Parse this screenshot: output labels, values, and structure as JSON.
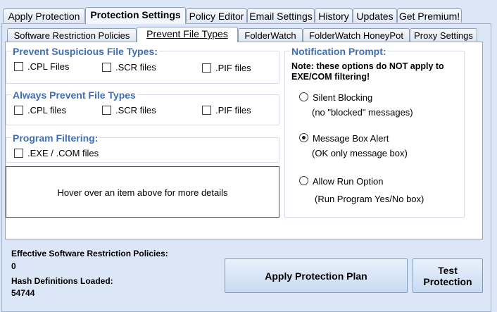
{
  "top_tabs": [
    {
      "label": "Apply Protection"
    },
    {
      "label": "Protection Settings"
    },
    {
      "label": "Policy Editor"
    },
    {
      "label": "Email Settings"
    },
    {
      "label": "History"
    },
    {
      "label": "Updates"
    },
    {
      "label": "Get Premium!"
    }
  ],
  "sub_tabs": [
    {
      "label": "Software Restriction Policies"
    },
    {
      "label": "Prevent File Types"
    },
    {
      "label": "FolderWatch"
    },
    {
      "label": "FolderWatch HoneyPot"
    },
    {
      "label": "Proxy Settings"
    }
  ],
  "suspicious": {
    "title": "Prevent Suspicious File Types:",
    "items": [
      {
        "label": ".CPL Files"
      },
      {
        "label": ".SCR files"
      },
      {
        "label": ".PIF files"
      }
    ]
  },
  "always": {
    "title": "Always Prevent File Types",
    "items": [
      {
        "label": ".CPL files"
      },
      {
        "label": ".SCR files"
      },
      {
        "label": ".PIF files"
      }
    ]
  },
  "program_filtering": {
    "title": "Program Filtering:",
    "items": [
      {
        "label": ".EXE / .COM files"
      }
    ]
  },
  "hover_text": "Hover over an item above for more details",
  "notification": {
    "title": "Notification Prompt:",
    "note": "Note: these options do NOT apply to EXE/COM filtering!",
    "options": [
      {
        "label": "Silent Blocking",
        "desc": "(no \"blocked\" messages)",
        "selected": false
      },
      {
        "label": "Message Box Alert",
        "desc": "(OK only message box)",
        "selected": true
      },
      {
        "label": "Allow Run Option",
        "desc": "(Run Program Yes/No box)",
        "selected": false
      }
    ]
  },
  "status": {
    "policies_label": "Effective Software Restriction Policies:",
    "policies_value": "0",
    "hash_label": "Hash Definitions Loaded:",
    "hash_value": "54744"
  },
  "buttons": {
    "apply": "Apply Protection Plan",
    "test": "Test Protection"
  }
}
